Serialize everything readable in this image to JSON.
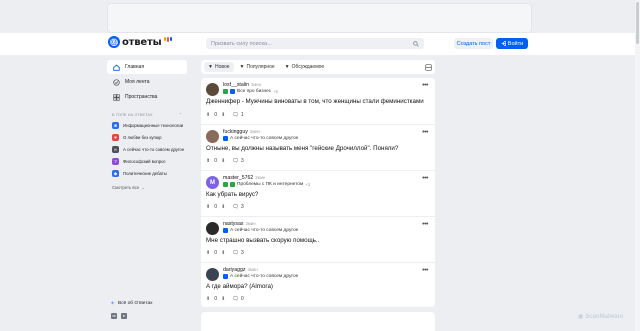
{
  "header": {
    "logo_text": "ответы",
    "search_placeholder": "Призвать силу поиска...",
    "ask_button": "Создать пост",
    "login_button": "Войти"
  },
  "sidebar": {
    "items": [
      {
        "label": "Главная",
        "icon": "home-icon",
        "active": true
      },
      {
        "label": "Моя лента",
        "icon": "feed-icon",
        "active": false
      },
      {
        "label": "Пространства",
        "icon": "spaces-icon",
        "active": false
      }
    ],
    "topics_title": "В ТОПЕ НА ОТВЕТАХ",
    "topics": [
      {
        "label": "Информационные технологии",
        "color": "#2a6df4"
      },
      {
        "label": "О любви без купюр",
        "color": "#e8414a"
      },
      {
        "label": "А сейчас что-то совсем другое",
        "color": "#4a4f59"
      },
      {
        "label": "Философский вопрос",
        "color": "#8e4ad9"
      },
      {
        "label": "Политические дебаты",
        "color": "#2a6df4"
      }
    ],
    "see_all": "Смотреть все",
    "all_answers": "Всё об Ответах"
  },
  "filters": {
    "tabs": [
      {
        "label": "Новое",
        "active": true
      },
      {
        "label": "Популярное",
        "active": false
      },
      {
        "label": "Обсуждаемое",
        "active": false
      }
    ]
  },
  "questions": [
    {
      "author": "losf__stalin",
      "time": "2мин",
      "category": "Все про бизнес",
      "extra": "+6",
      "text": "Дженнифер - Мужчины виноваты в том, что женщины стали феминистками",
      "votes": "0",
      "comments": "1",
      "avatar_color": "#5b4a3a",
      "avatar_letter": ""
    },
    {
      "author": "fuckingguy",
      "time": "2мин",
      "category": "А сейчас что-то совсем другое",
      "extra": "",
      "text": "Отныне, вы должны называть меня \"гейские Дрочиллой\". Поняли?",
      "votes": "0",
      "comments": "3",
      "avatar_color": "#8a6a5a",
      "avatar_letter": ""
    },
    {
      "author": "master_5762",
      "time": "2мин",
      "category": "Проблемы с ПК и интернетом",
      "extra": "+2",
      "text": "Как убрать вирус?",
      "votes": "0",
      "comments": "3",
      "avatar_color": "#7a63e8",
      "avatar_letter": "M"
    },
    {
      "author": "nastysas",
      "time": "3мин",
      "category": "А сейчас что-то совсем другое",
      "extra": "",
      "text": "Мне страшно вызвать скорую помощь..",
      "votes": "0",
      "comments": "3",
      "avatar_color": "#2a2a2a",
      "avatar_letter": ""
    },
    {
      "author": "dariyaggz",
      "time": "3мин",
      "category": "А сейчас что-то совсем другое",
      "extra": "",
      "text": "А где аймора? (Almora)",
      "votes": "0",
      "comments": "0",
      "avatar_color": "#3a4452",
      "avatar_letter": ""
    }
  ],
  "watermark": "ScanMalware"
}
